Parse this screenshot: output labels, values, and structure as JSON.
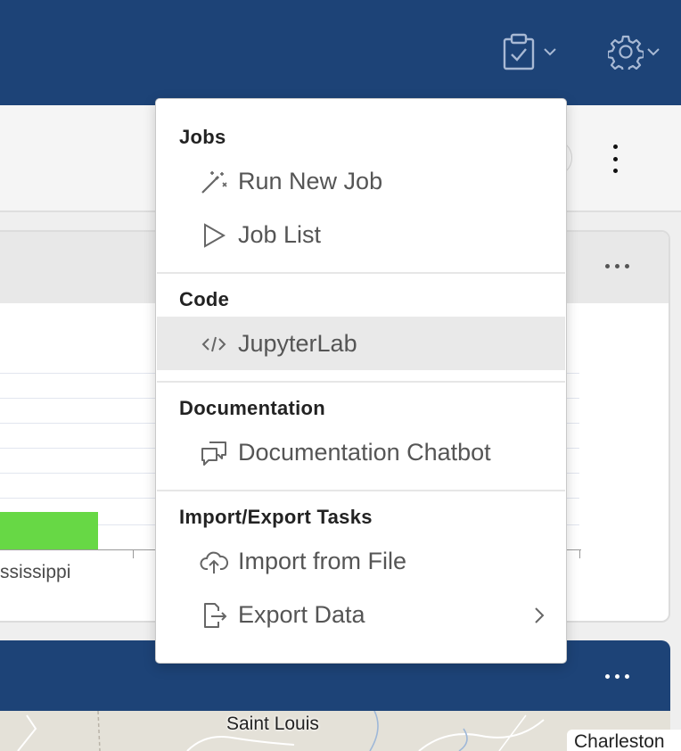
{
  "menu": {
    "sections": [
      {
        "title": "Jobs",
        "items": [
          {
            "label": "Run New Job",
            "icon": "magic-wand-icon"
          },
          {
            "label": "Job List",
            "icon": "play-icon"
          }
        ]
      },
      {
        "title": "Code",
        "items": [
          {
            "label": "JupyterLab",
            "icon": "code-icon",
            "active": true
          }
        ]
      },
      {
        "title": "Documentation",
        "items": [
          {
            "label": "Documentation Chatbot",
            "icon": "chat-bubbles-icon"
          }
        ]
      },
      {
        "title": "Import/Export Tasks",
        "items": [
          {
            "label": "Import from File",
            "icon": "cloud-upload-icon"
          },
          {
            "label": "Export Data",
            "icon": "export-icon",
            "submenu": true
          }
        ]
      }
    ]
  },
  "chart": {
    "x_label": "ssissippi"
  },
  "map": {
    "city_label": "Saint Louis",
    "city_label_2": "Charleston"
  },
  "colors": {
    "header": "#1d4377",
    "bar": "#67d845",
    "menu_active": "#e9e9e9"
  }
}
